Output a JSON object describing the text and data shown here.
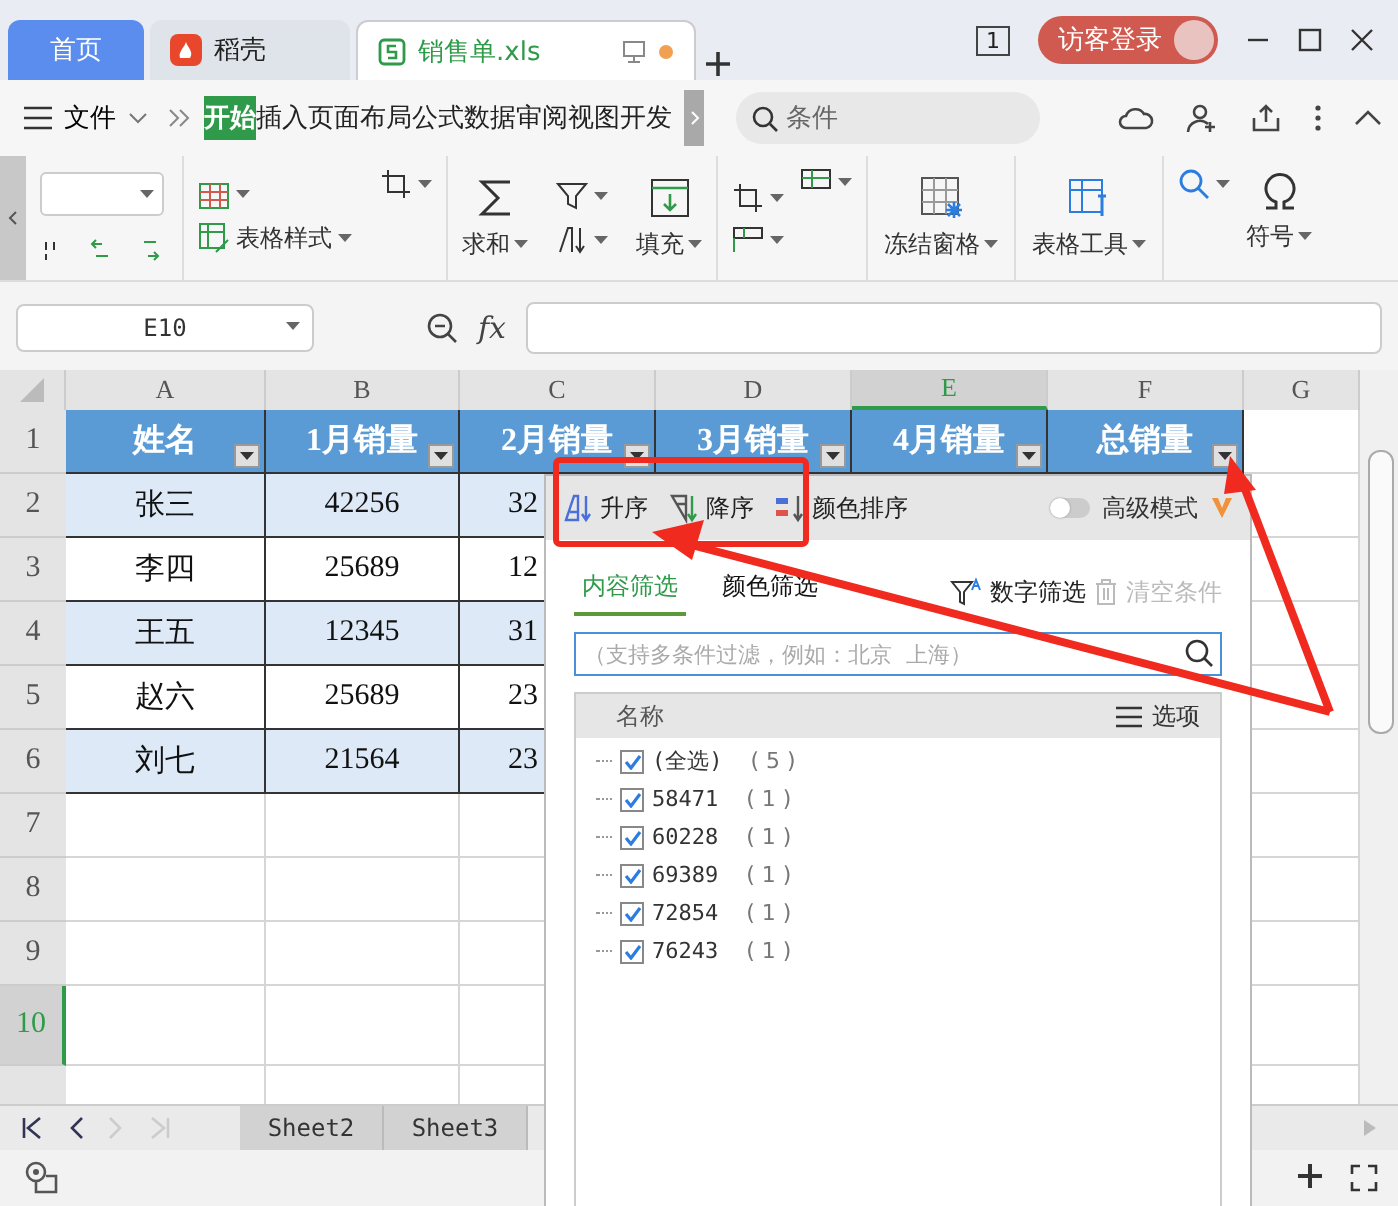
{
  "title_tabs": [
    {
      "label": "首页",
      "kind": "home",
      "selected": false
    },
    {
      "label": "稻壳",
      "kind": "docer",
      "selected": false
    },
    {
      "label": "销售单.xls",
      "kind": "sheet",
      "selected": true
    }
  ],
  "window_count": "1",
  "login": "访客登录",
  "menu": {
    "file": "文件",
    "tabs": [
      {
        "label": "开始",
        "selected": true
      },
      {
        "label": "插入",
        "selected": false
      },
      {
        "label": "页面布局",
        "selected": false
      },
      {
        "label": "公式",
        "selected": false
      },
      {
        "label": "数据",
        "selected": false
      },
      {
        "label": "审阅",
        "selected": false
      },
      {
        "label": "视图",
        "selected": false
      },
      {
        "label": "开发",
        "selected": false
      }
    ],
    "search_placeholder": "条件"
  },
  "ribbon": {
    "table_style": "表格样式",
    "sum": "求和",
    "fill": "填充",
    "freeze": "冻结窗格",
    "table_tools": "表格工具",
    "symbol": "符号"
  },
  "formula_bar": {
    "cell": "E10",
    "fx": "fx"
  },
  "columns": [
    {
      "label": "A",
      "selected": false
    },
    {
      "label": "B",
      "selected": false
    },
    {
      "label": "C",
      "selected": false
    },
    {
      "label": "D",
      "selected": false
    },
    {
      "label": "E",
      "selected": true
    },
    {
      "label": "F",
      "selected": false
    },
    {
      "label": "G",
      "selected": false
    }
  ],
  "rows": [
    {
      "number": "1",
      "selected": false,
      "kind": "header",
      "cells": [
        "姓名",
        "1月销量",
        "2月销量",
        "3月销量",
        "4月销量",
        "总销量"
      ]
    },
    {
      "number": "2",
      "selected": false,
      "kind": "data",
      "banded": true,
      "cells": [
        "张三",
        "42256",
        "32"
      ]
    },
    {
      "number": "3",
      "selected": false,
      "kind": "data",
      "banded": false,
      "cells": [
        "李四",
        "25689",
        "12"
      ]
    },
    {
      "number": "4",
      "selected": false,
      "kind": "data",
      "banded": true,
      "cells": [
        "王五",
        "12345",
        "31"
      ]
    },
    {
      "number": "5",
      "selected": false,
      "kind": "data",
      "banded": false,
      "cells": [
        "赵六",
        "25689",
        "23"
      ]
    },
    {
      "number": "6",
      "selected": false,
      "kind": "data",
      "banded": true,
      "cells": [
        "刘七",
        "21564",
        "23"
      ]
    },
    {
      "number": "7",
      "selected": false,
      "kind": "empty"
    },
    {
      "number": "8",
      "selected": false,
      "kind": "empty"
    },
    {
      "number": "9",
      "selected": false,
      "kind": "empty"
    },
    {
      "number": "10",
      "selected": true,
      "kind": "empty"
    }
  ],
  "sheet_tabs": [
    {
      "label": "Sheet2",
      "selected": false
    },
    {
      "label": "Sheet3",
      "selected": false
    }
  ],
  "filter": {
    "sort": [
      "升序",
      "降序",
      "颜色排序"
    ],
    "advanced": {
      "label": "高级模式",
      "on": false
    },
    "tabs": [
      {
        "label": "内容筛选",
        "selected": true
      },
      {
        "label": "颜色筛选",
        "selected": false
      }
    ],
    "number_filter": "数字筛选",
    "clear": {
      "label": "清空条件",
      "disabled": true
    },
    "search_placeholder": "（支持多条件过滤，例如：北京  上海）",
    "list_header": "名称",
    "options": "选项",
    "items": [
      {
        "label": "(全选)",
        "count": "( 5 )",
        "checked": true
      },
      {
        "label": "58471",
        "count": "( 1 )",
        "checked": true
      },
      {
        "label": "60228",
        "count": "( 1 )",
        "checked": true
      },
      {
        "label": "69389",
        "count": "( 1 )",
        "checked": true
      },
      {
        "label": "72854",
        "count": "( 1 )",
        "checked": true
      },
      {
        "label": "76243",
        "count": "( 1 )",
        "checked": true
      }
    ]
  }
}
